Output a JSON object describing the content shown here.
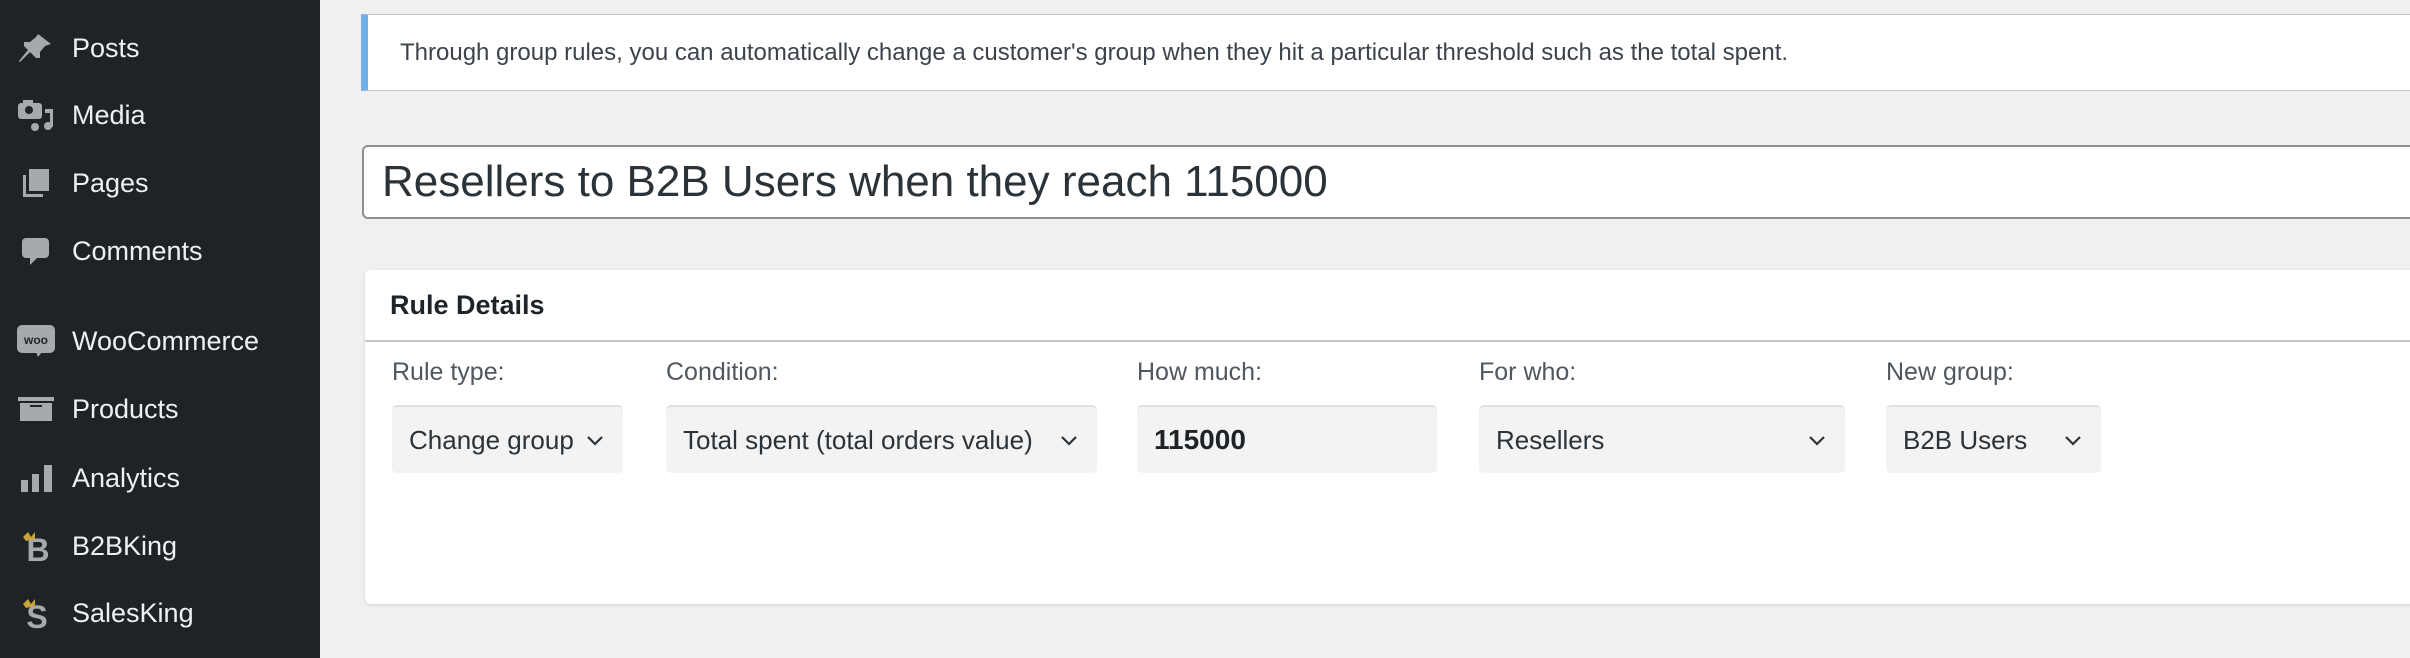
{
  "sidebar": {
    "items": [
      {
        "label": "Posts",
        "icon": "pin-icon"
      },
      {
        "label": "Media",
        "icon": "media-icon"
      },
      {
        "label": "Pages",
        "icon": "pages-icon"
      },
      {
        "label": "Comments",
        "icon": "comment-icon"
      },
      {
        "label": "WooCommerce",
        "icon": "woocommerce-icon"
      },
      {
        "label": "Products",
        "icon": "archive-icon"
      },
      {
        "label": "Analytics",
        "icon": "bar-chart-icon"
      },
      {
        "label": "B2BKing",
        "icon": "b2bking-icon"
      },
      {
        "label": "SalesKing",
        "icon": "salesking-icon"
      }
    ]
  },
  "notice": {
    "text": "Through group rules, you can automatically change a customer's group when they hit a particular threshold such as the total spent."
  },
  "title": {
    "value": "Resellers to B2B Users when they reach 115000"
  },
  "rule_details": {
    "heading": "Rule Details",
    "rule_type": {
      "label": "Rule type:",
      "value": "Change group"
    },
    "condition": {
      "label": "Condition:",
      "value": "Total spent (total orders value)"
    },
    "how_much": {
      "label": "How much:",
      "value": "115000"
    },
    "for_who": {
      "label": "For who:",
      "value": "Resellers"
    },
    "new_group": {
      "label": "New group:",
      "value": "B2B Users"
    }
  },
  "colors": {
    "sidebar_bg": "#1d2327",
    "notice_accent": "#72aee6",
    "king_gold": "#c9a23a"
  }
}
